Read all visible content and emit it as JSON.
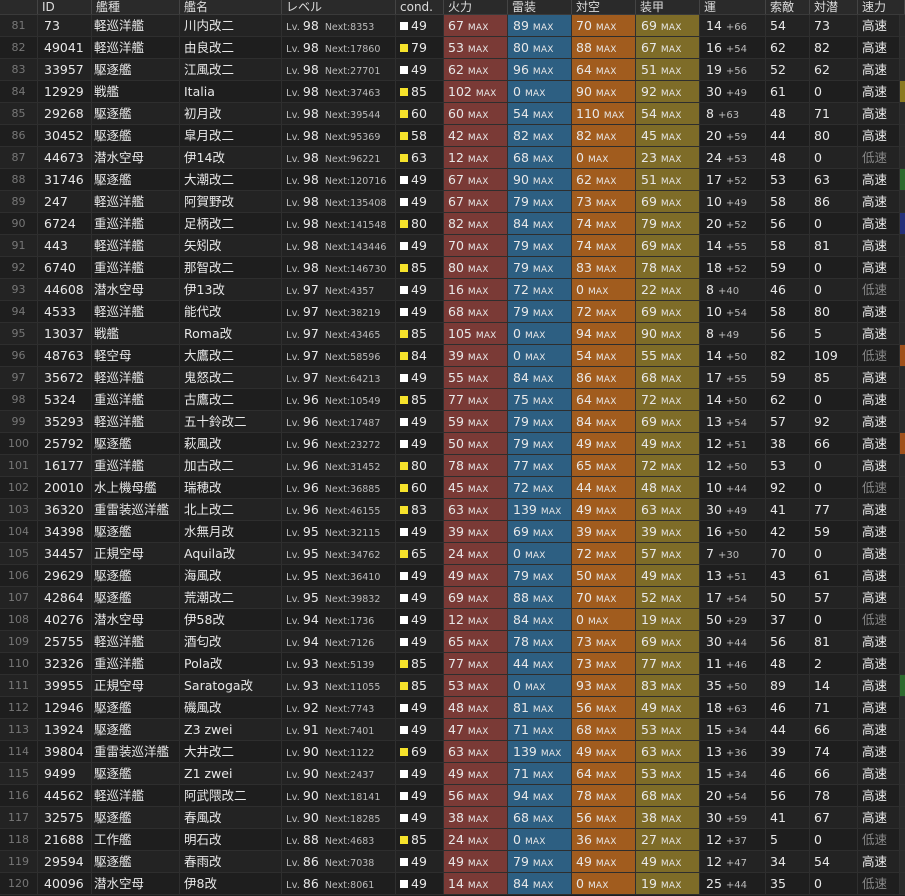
{
  "colors": {
    "cond_white": "#ffffff",
    "cond_yellow": "#f5e22b",
    "firepower": "#7a3a36",
    "torpedo": "#2d5f82",
    "antiair": "#a15c1e",
    "armor": "#7e6c28"
  },
  "headers": {
    "no": "",
    "id": "ID",
    "type": "艦種",
    "name": "艦名",
    "level": "レベル",
    "cond": "cond.",
    "firepower": "火力",
    "torpedo": "雷装",
    "antiair": "対空",
    "armor": "装甲",
    "luck": "運",
    "los": "索敵",
    "asw": "対潜",
    "speed": "速力"
  },
  "labels": {
    "lv": "Lv.",
    "next": "Next:",
    "max": "MAX"
  },
  "rows": [
    {
      "no": "81",
      "id": "73",
      "type": "軽巡洋艦",
      "name": "川内改二",
      "lv": "98",
      "next": "8353",
      "cond": "49",
      "cc": "w",
      "fp": "67",
      "tp": "89",
      "aa": "70",
      "ar": "69",
      "luck": "14",
      "lp": "+66",
      "los": "54",
      "asw": "73",
      "spd": "高速",
      "edge": "#2a2a2a"
    },
    {
      "no": "82",
      "id": "49041",
      "type": "軽巡洋艦",
      "name": "由良改二",
      "lv": "98",
      "next": "17860",
      "cond": "79",
      "cc": "y",
      "fp": "53",
      "tp": "80",
      "aa": "88",
      "ar": "67",
      "luck": "16",
      "lp": "+54",
      "los": "62",
      "asw": "82",
      "spd": "高速",
      "edge": "#2a2a2a"
    },
    {
      "no": "83",
      "id": "33957",
      "type": "駆逐艦",
      "name": "江風改二",
      "lv": "98",
      "next": "27701",
      "cond": "49",
      "cc": "w",
      "fp": "62",
      "tp": "96",
      "aa": "64",
      "ar": "51",
      "luck": "19",
      "lp": "+56",
      "los": "52",
      "asw": "62",
      "spd": "高速",
      "edge": "#2a2a2a"
    },
    {
      "no": "84",
      "id": "12929",
      "type": "戦艦",
      "name": "Italia",
      "lv": "98",
      "next": "37463",
      "cond": "85",
      "cc": "y",
      "fp": "102",
      "tp": "0",
      "aa": "90",
      "ar": "92",
      "luck": "30",
      "lp": "+49",
      "los": "61",
      "asw": "0",
      "spd": "高速",
      "edge": "#8a7a20"
    },
    {
      "no": "85",
      "id": "29268",
      "type": "駆逐艦",
      "name": "初月改",
      "lv": "98",
      "next": "39544",
      "cond": "60",
      "cc": "y",
      "fp": "60",
      "tp": "54",
      "aa": "110",
      "ar": "54",
      "luck": "8",
      "lp": "+63",
      "los": "48",
      "asw": "71",
      "spd": "高速",
      "edge": "#2a2a2a"
    },
    {
      "no": "86",
      "id": "30452",
      "type": "駆逐艦",
      "name": "皐月改二",
      "lv": "98",
      "next": "95369",
      "cond": "58",
      "cc": "y",
      "fp": "42",
      "tp": "82",
      "aa": "82",
      "ar": "45",
      "luck": "20",
      "lp": "+59",
      "los": "44",
      "asw": "80",
      "spd": "高速",
      "edge": "#2a2a2a"
    },
    {
      "no": "87",
      "id": "44673",
      "type": "潜水空母",
      "name": "伊14改",
      "lv": "98",
      "next": "96221",
      "cond": "63",
      "cc": "y",
      "fp": "12",
      "tp": "68",
      "aa": "0",
      "ar": "23",
      "luck": "24",
      "lp": "+53",
      "los": "48",
      "asw": "0",
      "spd": "低速",
      "edge": "#2a2a2a"
    },
    {
      "no": "88",
      "id": "31746",
      "type": "駆逐艦",
      "name": "大潮改二",
      "lv": "98",
      "next": "120716",
      "cond": "49",
      "cc": "w",
      "fp": "67",
      "tp": "90",
      "aa": "62",
      "ar": "51",
      "luck": "17",
      "lp": "+52",
      "los": "53",
      "asw": "63",
      "spd": "高速",
      "edge": "#2d6a2d"
    },
    {
      "no": "89",
      "id": "247",
      "type": "軽巡洋艦",
      "name": "阿賀野改",
      "lv": "98",
      "next": "135408",
      "cond": "49",
      "cc": "w",
      "fp": "67",
      "tp": "79",
      "aa": "73",
      "ar": "69",
      "luck": "10",
      "lp": "+49",
      "los": "58",
      "asw": "86",
      "spd": "高速",
      "edge": "#2a2a2a"
    },
    {
      "no": "90",
      "id": "6724",
      "type": "重巡洋艦",
      "name": "足柄改二",
      "lv": "98",
      "next": "141548",
      "cond": "80",
      "cc": "y",
      "fp": "82",
      "tp": "84",
      "aa": "74",
      "ar": "79",
      "luck": "20",
      "lp": "+52",
      "los": "56",
      "asw": "0",
      "spd": "高速",
      "edge": "#24307a"
    },
    {
      "no": "91",
      "id": "443",
      "type": "軽巡洋艦",
      "name": "矢矧改",
      "lv": "98",
      "next": "143446",
      "cond": "49",
      "cc": "w",
      "fp": "70",
      "tp": "79",
      "aa": "74",
      "ar": "69",
      "luck": "14",
      "lp": "+55",
      "los": "58",
      "asw": "81",
      "spd": "高速",
      "edge": "#2a2a2a"
    },
    {
      "no": "92",
      "id": "6740",
      "type": "重巡洋艦",
      "name": "那智改二",
      "lv": "98",
      "next": "146730",
      "cond": "85",
      "cc": "y",
      "fp": "80",
      "tp": "79",
      "aa": "83",
      "ar": "78",
      "luck": "18",
      "lp": "+52",
      "los": "59",
      "asw": "0",
      "spd": "高速",
      "edge": "#2a2a2a"
    },
    {
      "no": "93",
      "id": "44608",
      "type": "潜水空母",
      "name": "伊13改",
      "lv": "97",
      "next": "4357",
      "cond": "49",
      "cc": "w",
      "fp": "16",
      "tp": "72",
      "aa": "0",
      "ar": "22",
      "luck": "8",
      "lp": "+40",
      "los": "46",
      "asw": "0",
      "spd": "低速",
      "edge": "#2a2a2a"
    },
    {
      "no": "94",
      "id": "4533",
      "type": "軽巡洋艦",
      "name": "能代改",
      "lv": "97",
      "next": "38219",
      "cond": "49",
      "cc": "w",
      "fp": "68",
      "tp": "79",
      "aa": "72",
      "ar": "69",
      "luck": "10",
      "lp": "+54",
      "los": "58",
      "asw": "80",
      "spd": "高速",
      "edge": "#2a2a2a"
    },
    {
      "no": "95",
      "id": "13037",
      "type": "戦艦",
      "name": "Roma改",
      "lv": "97",
      "next": "43465",
      "cond": "85",
      "cc": "y",
      "fp": "105",
      "tp": "0",
      "aa": "94",
      "ar": "90",
      "luck": "8",
      "lp": "+49",
      "los": "56",
      "asw": "5",
      "spd": "高速",
      "edge": "#2a2a2a"
    },
    {
      "no": "96",
      "id": "48763",
      "type": "軽空母",
      "name": "大鷹改二",
      "lv": "97",
      "next": "58596",
      "cond": "84",
      "cc": "y",
      "fp": "39",
      "tp": "0",
      "aa": "54",
      "ar": "55",
      "luck": "14",
      "lp": "+50",
      "los": "82",
      "asw": "109",
      "spd": "低速",
      "edge": "#a0501a"
    },
    {
      "no": "97",
      "id": "35672",
      "type": "軽巡洋艦",
      "name": "鬼怒改二",
      "lv": "97",
      "next": "64213",
      "cond": "49",
      "cc": "w",
      "fp": "55",
      "tp": "84",
      "aa": "86",
      "ar": "68",
      "luck": "17",
      "lp": "+55",
      "los": "59",
      "asw": "85",
      "spd": "高速",
      "edge": "#2a2a2a"
    },
    {
      "no": "98",
      "id": "5324",
      "type": "重巡洋艦",
      "name": "古鷹改二",
      "lv": "96",
      "next": "10549",
      "cond": "85",
      "cc": "y",
      "fp": "77",
      "tp": "75",
      "aa": "64",
      "ar": "72",
      "luck": "14",
      "lp": "+50",
      "los": "62",
      "asw": "0",
      "spd": "高速",
      "edge": "#2a2a2a"
    },
    {
      "no": "99",
      "id": "35293",
      "type": "軽巡洋艦",
      "name": "五十鈴改二",
      "lv": "96",
      "next": "17487",
      "cond": "49",
      "cc": "w",
      "fp": "59",
      "tp": "79",
      "aa": "84",
      "ar": "69",
      "luck": "13",
      "lp": "+54",
      "los": "57",
      "asw": "92",
      "spd": "高速",
      "edge": "#2a2a2a"
    },
    {
      "no": "100",
      "id": "25792",
      "type": "駆逐艦",
      "name": "萩風改",
      "lv": "96",
      "next": "23272",
      "cond": "49",
      "cc": "w",
      "fp": "50",
      "tp": "79",
      "aa": "49",
      "ar": "49",
      "luck": "12",
      "lp": "+51",
      "los": "38",
      "asw": "66",
      "spd": "高速",
      "edge": "#a0501a"
    },
    {
      "no": "101",
      "id": "16177",
      "type": "重巡洋艦",
      "name": "加古改二",
      "lv": "96",
      "next": "31452",
      "cond": "80",
      "cc": "y",
      "fp": "78",
      "tp": "77",
      "aa": "65",
      "ar": "72",
      "luck": "12",
      "lp": "+50",
      "los": "53",
      "asw": "0",
      "spd": "高速",
      "edge": "#2a2a2a"
    },
    {
      "no": "102",
      "id": "20010",
      "type": "水上機母艦",
      "name": "瑞穂改",
      "lv": "96",
      "next": "36885",
      "cond": "60",
      "cc": "y",
      "fp": "45",
      "tp": "72",
      "aa": "44",
      "ar": "48",
      "luck": "10",
      "lp": "+44",
      "los": "92",
      "asw": "0",
      "spd": "低速",
      "edge": "#2a2a2a"
    },
    {
      "no": "103",
      "id": "36320",
      "type": "重雷装巡洋艦",
      "name": "北上改二",
      "lv": "96",
      "next": "46155",
      "cond": "83",
      "cc": "y",
      "fp": "63",
      "tp": "139",
      "aa": "49",
      "ar": "63",
      "luck": "30",
      "lp": "+49",
      "los": "41",
      "asw": "77",
      "spd": "高速",
      "edge": "#2a2a2a"
    },
    {
      "no": "104",
      "id": "34398",
      "type": "駆逐艦",
      "name": "水無月改",
      "lv": "95",
      "next": "32115",
      "cond": "49",
      "cc": "w",
      "fp": "39",
      "tp": "69",
      "aa": "39",
      "ar": "39",
      "luck": "16",
      "lp": "+50",
      "los": "42",
      "asw": "59",
      "spd": "高速",
      "edge": "#2a2a2a"
    },
    {
      "no": "105",
      "id": "34457",
      "type": "正規空母",
      "name": "Aquila改",
      "lv": "95",
      "next": "34762",
      "cond": "65",
      "cc": "y",
      "fp": "24",
      "tp": "0",
      "aa": "72",
      "ar": "57",
      "luck": "7",
      "lp": "+30",
      "los": "70",
      "asw": "0",
      "spd": "高速",
      "edge": "#2a2a2a"
    },
    {
      "no": "106",
      "id": "29629",
      "type": "駆逐艦",
      "name": "海風改",
      "lv": "95",
      "next": "36410",
      "cond": "49",
      "cc": "w",
      "fp": "49",
      "tp": "79",
      "aa": "50",
      "ar": "49",
      "luck": "13",
      "lp": "+51",
      "los": "43",
      "asw": "61",
      "spd": "高速",
      "edge": "#2a2a2a"
    },
    {
      "no": "107",
      "id": "42864",
      "type": "駆逐艦",
      "name": "荒潮改二",
      "lv": "95",
      "next": "39832",
      "cond": "49",
      "cc": "w",
      "fp": "69",
      "tp": "88",
      "aa": "70",
      "ar": "52",
      "luck": "17",
      "lp": "+54",
      "los": "50",
      "asw": "57",
      "spd": "高速",
      "edge": "#2a2a2a"
    },
    {
      "no": "108",
      "id": "40276",
      "type": "潜水空母",
      "name": "伊58改",
      "lv": "94",
      "next": "1736",
      "cond": "49",
      "cc": "w",
      "fp": "12",
      "tp": "84",
      "aa": "0",
      "ar": "19",
      "luck": "50",
      "lp": "+29",
      "los": "37",
      "asw": "0",
      "spd": "低速",
      "edge": "#2a2a2a"
    },
    {
      "no": "109",
      "id": "25755",
      "type": "軽巡洋艦",
      "name": "酒匂改",
      "lv": "94",
      "next": "7126",
      "cond": "49",
      "cc": "w",
      "fp": "65",
      "tp": "78",
      "aa": "73",
      "ar": "69",
      "luck": "30",
      "lp": "+44",
      "los": "56",
      "asw": "81",
      "spd": "高速",
      "edge": "#2a2a2a"
    },
    {
      "no": "110",
      "id": "32326",
      "type": "重巡洋艦",
      "name": "Pola改",
      "lv": "93",
      "next": "5139",
      "cond": "85",
      "cc": "y",
      "fp": "77",
      "tp": "44",
      "aa": "73",
      "ar": "77",
      "luck": "11",
      "lp": "+46",
      "los": "48",
      "asw": "2",
      "spd": "高速",
      "edge": "#2a2a2a"
    },
    {
      "no": "111",
      "id": "39955",
      "type": "正規空母",
      "name": "Saratoga改",
      "lv": "93",
      "next": "11055",
      "cond": "85",
      "cc": "y",
      "fp": "53",
      "tp": "0",
      "aa": "93",
      "ar": "83",
      "luck": "35",
      "lp": "+50",
      "los": "89",
      "asw": "14",
      "spd": "高速",
      "edge": "#2d6a2d"
    },
    {
      "no": "112",
      "id": "12946",
      "type": "駆逐艦",
      "name": "磯風改",
      "lv": "92",
      "next": "7743",
      "cond": "49",
      "cc": "w",
      "fp": "48",
      "tp": "81",
      "aa": "56",
      "ar": "49",
      "luck": "18",
      "lp": "+63",
      "los": "46",
      "asw": "71",
      "spd": "高速",
      "edge": "#2a2a2a"
    },
    {
      "no": "113",
      "id": "13924",
      "type": "駆逐艦",
      "name": "Z3 zwei",
      "lv": "91",
      "next": "7401",
      "cond": "49",
      "cc": "w",
      "fp": "47",
      "tp": "71",
      "aa": "68",
      "ar": "53",
      "luck": "15",
      "lp": "+34",
      "los": "44",
      "asw": "66",
      "spd": "高速",
      "edge": "#2a2a2a"
    },
    {
      "no": "114",
      "id": "39804",
      "type": "重雷装巡洋艦",
      "name": "大井改二",
      "lv": "90",
      "next": "1122",
      "cond": "69",
      "cc": "y",
      "fp": "63",
      "tp": "139",
      "aa": "49",
      "ar": "63",
      "luck": "13",
      "lp": "+36",
      "los": "39",
      "asw": "74",
      "spd": "高速",
      "edge": "#2a2a2a"
    },
    {
      "no": "115",
      "id": "9499",
      "type": "駆逐艦",
      "name": "Z1 zwei",
      "lv": "90",
      "next": "2437",
      "cond": "49",
      "cc": "w",
      "fp": "49",
      "tp": "71",
      "aa": "64",
      "ar": "53",
      "luck": "15",
      "lp": "+34",
      "los": "46",
      "asw": "66",
      "spd": "高速",
      "edge": "#2a2a2a"
    },
    {
      "no": "116",
      "id": "44562",
      "type": "軽巡洋艦",
      "name": "阿武隈改二",
      "lv": "90",
      "next": "18141",
      "cond": "49",
      "cc": "w",
      "fp": "56",
      "tp": "94",
      "aa": "78",
      "ar": "68",
      "luck": "20",
      "lp": "+54",
      "los": "56",
      "asw": "78",
      "spd": "高速",
      "edge": "#2a2a2a"
    },
    {
      "no": "117",
      "id": "32575",
      "type": "駆逐艦",
      "name": "春風改",
      "lv": "90",
      "next": "18285",
      "cond": "49",
      "cc": "w",
      "fp": "38",
      "tp": "68",
      "aa": "56",
      "ar": "38",
      "luck": "30",
      "lp": "+59",
      "los": "41",
      "asw": "67",
      "spd": "高速",
      "edge": "#2a2a2a"
    },
    {
      "no": "118",
      "id": "21688",
      "type": "工作艦",
      "name": "明石改",
      "lv": "88",
      "next": "4683",
      "cond": "85",
      "cc": "y",
      "fp": "24",
      "tp": "0",
      "aa": "36",
      "ar": "27",
      "luck": "12",
      "lp": "+37",
      "los": "5",
      "asw": "0",
      "spd": "低速",
      "edge": "#2a2a2a"
    },
    {
      "no": "119",
      "id": "29594",
      "type": "駆逐艦",
      "name": "春雨改",
      "lv": "86",
      "next": "7038",
      "cond": "49",
      "cc": "w",
      "fp": "49",
      "tp": "79",
      "aa": "49",
      "ar": "49",
      "luck": "12",
      "lp": "+47",
      "los": "34",
      "asw": "54",
      "spd": "高速",
      "edge": "#2a2a2a"
    },
    {
      "no": "120",
      "id": "40096",
      "type": "潜水空母",
      "name": "伊8改",
      "lv": "86",
      "next": "8061",
      "cond": "49",
      "cc": "w",
      "fp": "14",
      "tp": "84",
      "aa": "0",
      "ar": "19",
      "luck": "25",
      "lp": "+44",
      "los": "35",
      "asw": "0",
      "spd": "低速",
      "edge": "#2a2a2a"
    }
  ]
}
